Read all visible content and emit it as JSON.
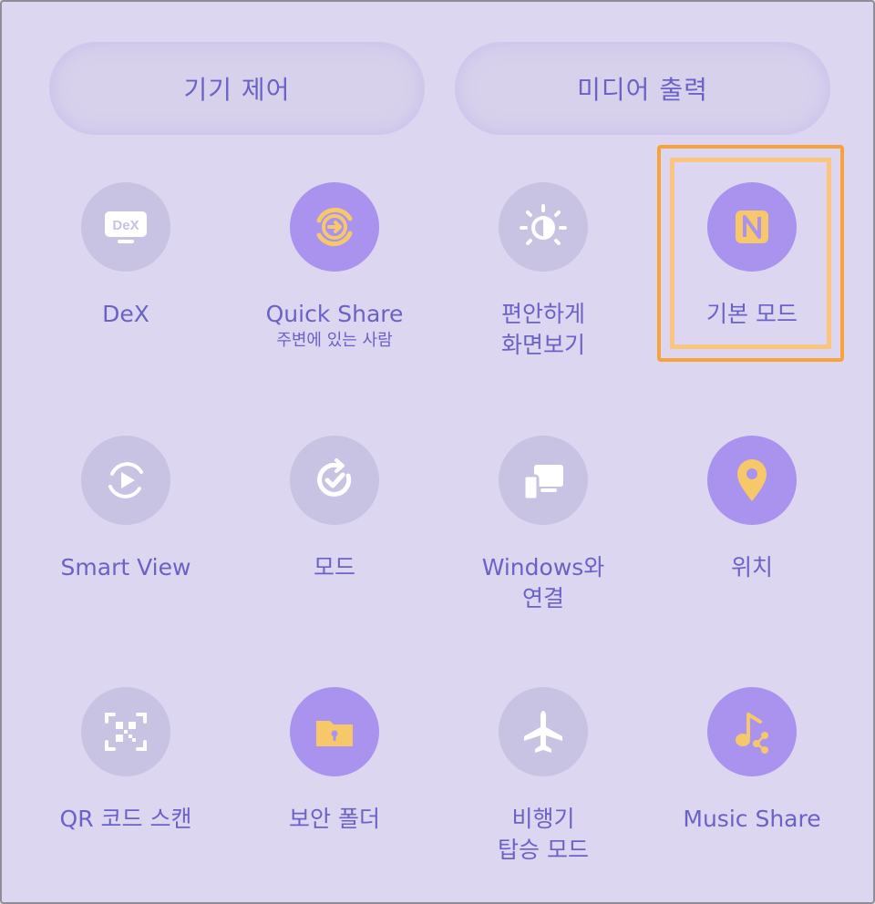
{
  "header": {
    "device_control": "기기 제어",
    "media_output": "미디어 출력"
  },
  "tiles": [
    {
      "label": "DeX",
      "sub": "",
      "icon": "dex-icon",
      "active": false
    },
    {
      "label": "Quick Share",
      "sub": "주변에 있는 사람",
      "icon": "quick-share-icon",
      "active": true
    },
    {
      "label": "편안하게\n화면보기",
      "sub": "",
      "icon": "eye-comfort-icon",
      "active": false
    },
    {
      "label": "기본 모드",
      "sub": "",
      "icon": "nfc-icon",
      "active": true
    },
    {
      "label": "Smart View",
      "sub": "",
      "icon": "smart-view-icon",
      "active": false
    },
    {
      "label": "모드",
      "sub": "",
      "icon": "modes-icon",
      "active": false
    },
    {
      "label": "Windows와\n연결",
      "sub": "",
      "icon": "link-windows-icon",
      "active": false
    },
    {
      "label": "위치",
      "sub": "",
      "icon": "location-icon",
      "active": true
    },
    {
      "label": "QR 코드 스캔",
      "sub": "",
      "icon": "qr-scan-icon",
      "active": false
    },
    {
      "label": "보안 폴더",
      "sub": "",
      "icon": "secure-folder-icon",
      "active": true
    },
    {
      "label": "비행기\n탑승 모드",
      "sub": "",
      "icon": "airplane-icon",
      "active": false
    },
    {
      "label": "Music Share",
      "sub": "",
      "icon": "music-share-icon",
      "active": true
    }
  ],
  "colors": {
    "background": "#ddd6f0",
    "label": "#6a62c7",
    "active_circle": "#a993ee",
    "inactive_circle": "#c8c2e3",
    "active_icon": "#f6c86a",
    "inactive_icon": "#ffffff",
    "highlight": "#f8a33a"
  }
}
